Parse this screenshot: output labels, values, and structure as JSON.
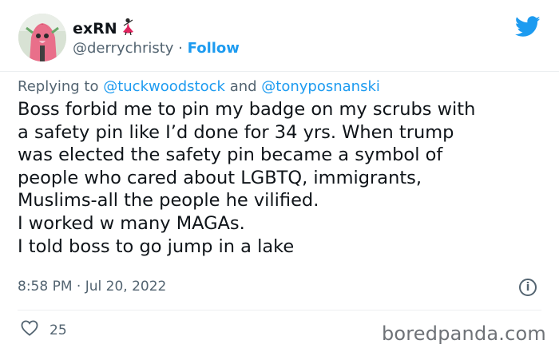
{
  "author": {
    "name": "exRN",
    "handle": "@derrychristy",
    "separator": "·",
    "follow_label": "Follow",
    "name_emoji": "dancer-emoji"
  },
  "reply": {
    "prefix": "Replying to",
    "mention1": "@tuckwoodstock",
    "conjunction": "and",
    "mention2": "@tonyposnanski"
  },
  "tweet": {
    "lines": [
      "Boss forbid me to pin my badge on my scrubs with",
      "a safety pin like I’d done for 34 yrs. When trump",
      "was elected the safety pin became a symbol of",
      "people who cared about LGBTQ, immigrants,",
      "Muslims-all the people he vilified.",
      "I worked w many MAGAs.",
      "I told boss to go jump in a lake"
    ],
    "time": "8:58 PM",
    "separator": "·",
    "date": "Jul 20, 2022",
    "likes": "25"
  },
  "watermark": "boredpanda.com",
  "colors": {
    "accent": "#1d9bf0",
    "text": "#0f1419",
    "muted": "#536471"
  }
}
